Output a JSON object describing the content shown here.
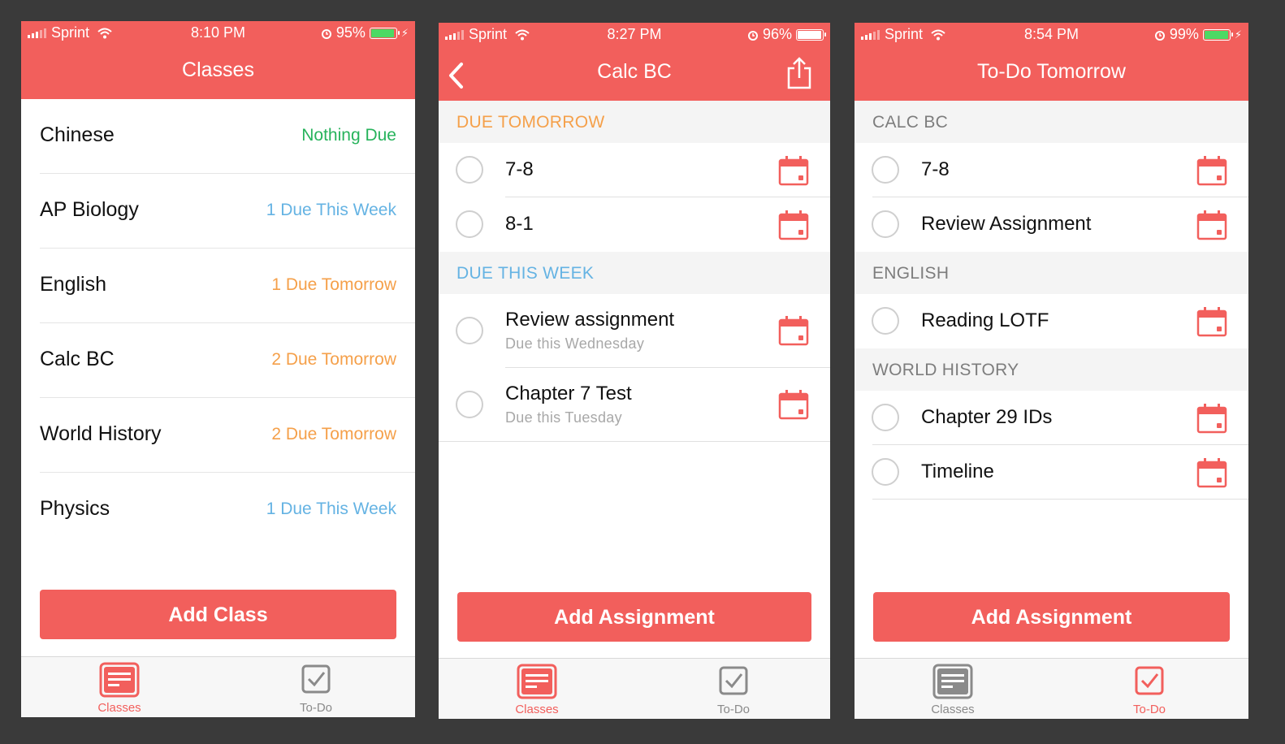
{
  "colors": {
    "accent": "#f25f5c",
    "green": "#27b35c",
    "blue": "#65b3e3",
    "orange": "#f5a04a",
    "gray_text": "#7d7d7d",
    "tab_gray": "#8a8a8a",
    "battery_green": "#4cd964"
  },
  "screens": [
    {
      "status": {
        "carrier": "Sprint",
        "time": "8:10 PM",
        "battery": "95%"
      },
      "title": "Classes",
      "classes": [
        {
          "name": "Chinese",
          "status": "Nothing Due",
          "status_color": "green"
        },
        {
          "name": "AP Biology",
          "status": "1 Due This Week",
          "status_color": "blue"
        },
        {
          "name": "English",
          "status": "1 Due Tomorrow",
          "status_color": "orange"
        },
        {
          "name": "Calc BC",
          "status": "2 Due Tomorrow",
          "status_color": "orange"
        },
        {
          "name": "World History",
          "status": "2 Due Tomorrow",
          "status_color": "orange"
        },
        {
          "name": "Physics",
          "status": "1 Due This Week",
          "status_color": "blue"
        }
      ],
      "button": "Add Class",
      "tabs": [
        {
          "label": "Classes",
          "icon": "classes-icon",
          "active": true
        },
        {
          "label": "To-Do",
          "icon": "todo-icon",
          "active": false
        }
      ]
    },
    {
      "status": {
        "carrier": "Sprint",
        "time": "8:27 PM",
        "battery": "96%"
      },
      "title": "Calc BC",
      "sections": [
        {
          "label": "DUE TOMORROW",
          "color": "orange",
          "items": [
            {
              "title": "7-8"
            },
            {
              "title": "8-1"
            }
          ]
        },
        {
          "label": "DUE THIS WEEK",
          "color": "blue",
          "items": [
            {
              "title": "Review assignment",
              "sub": "Due this Wednesday"
            },
            {
              "title": "Chapter 7 Test",
              "sub": "Due this Tuesday"
            }
          ]
        }
      ],
      "button": "Add Assignment",
      "tabs": [
        {
          "label": "Classes",
          "icon": "classes-icon",
          "active": true
        },
        {
          "label": "To-Do",
          "icon": "todo-icon",
          "active": false
        }
      ]
    },
    {
      "status": {
        "carrier": "Sprint",
        "time": "8:54 PM",
        "battery": "99%"
      },
      "title": "To-Do Tomorrow",
      "sections": [
        {
          "label": "CALC BC",
          "items": [
            {
              "title": "7-8"
            },
            {
              "title": "Review Assignment"
            }
          ]
        },
        {
          "label": "ENGLISH",
          "items": [
            {
              "title": "Reading LOTF"
            }
          ]
        },
        {
          "label": "WORLD HISTORY",
          "items": [
            {
              "title": "Chapter 29 IDs"
            },
            {
              "title": "Timeline"
            }
          ]
        }
      ],
      "button": "Add Assignment",
      "tabs": [
        {
          "label": "Classes",
          "icon": "classes-icon",
          "active": false
        },
        {
          "label": "To-Do",
          "icon": "todo-icon",
          "active": true
        }
      ]
    }
  ]
}
